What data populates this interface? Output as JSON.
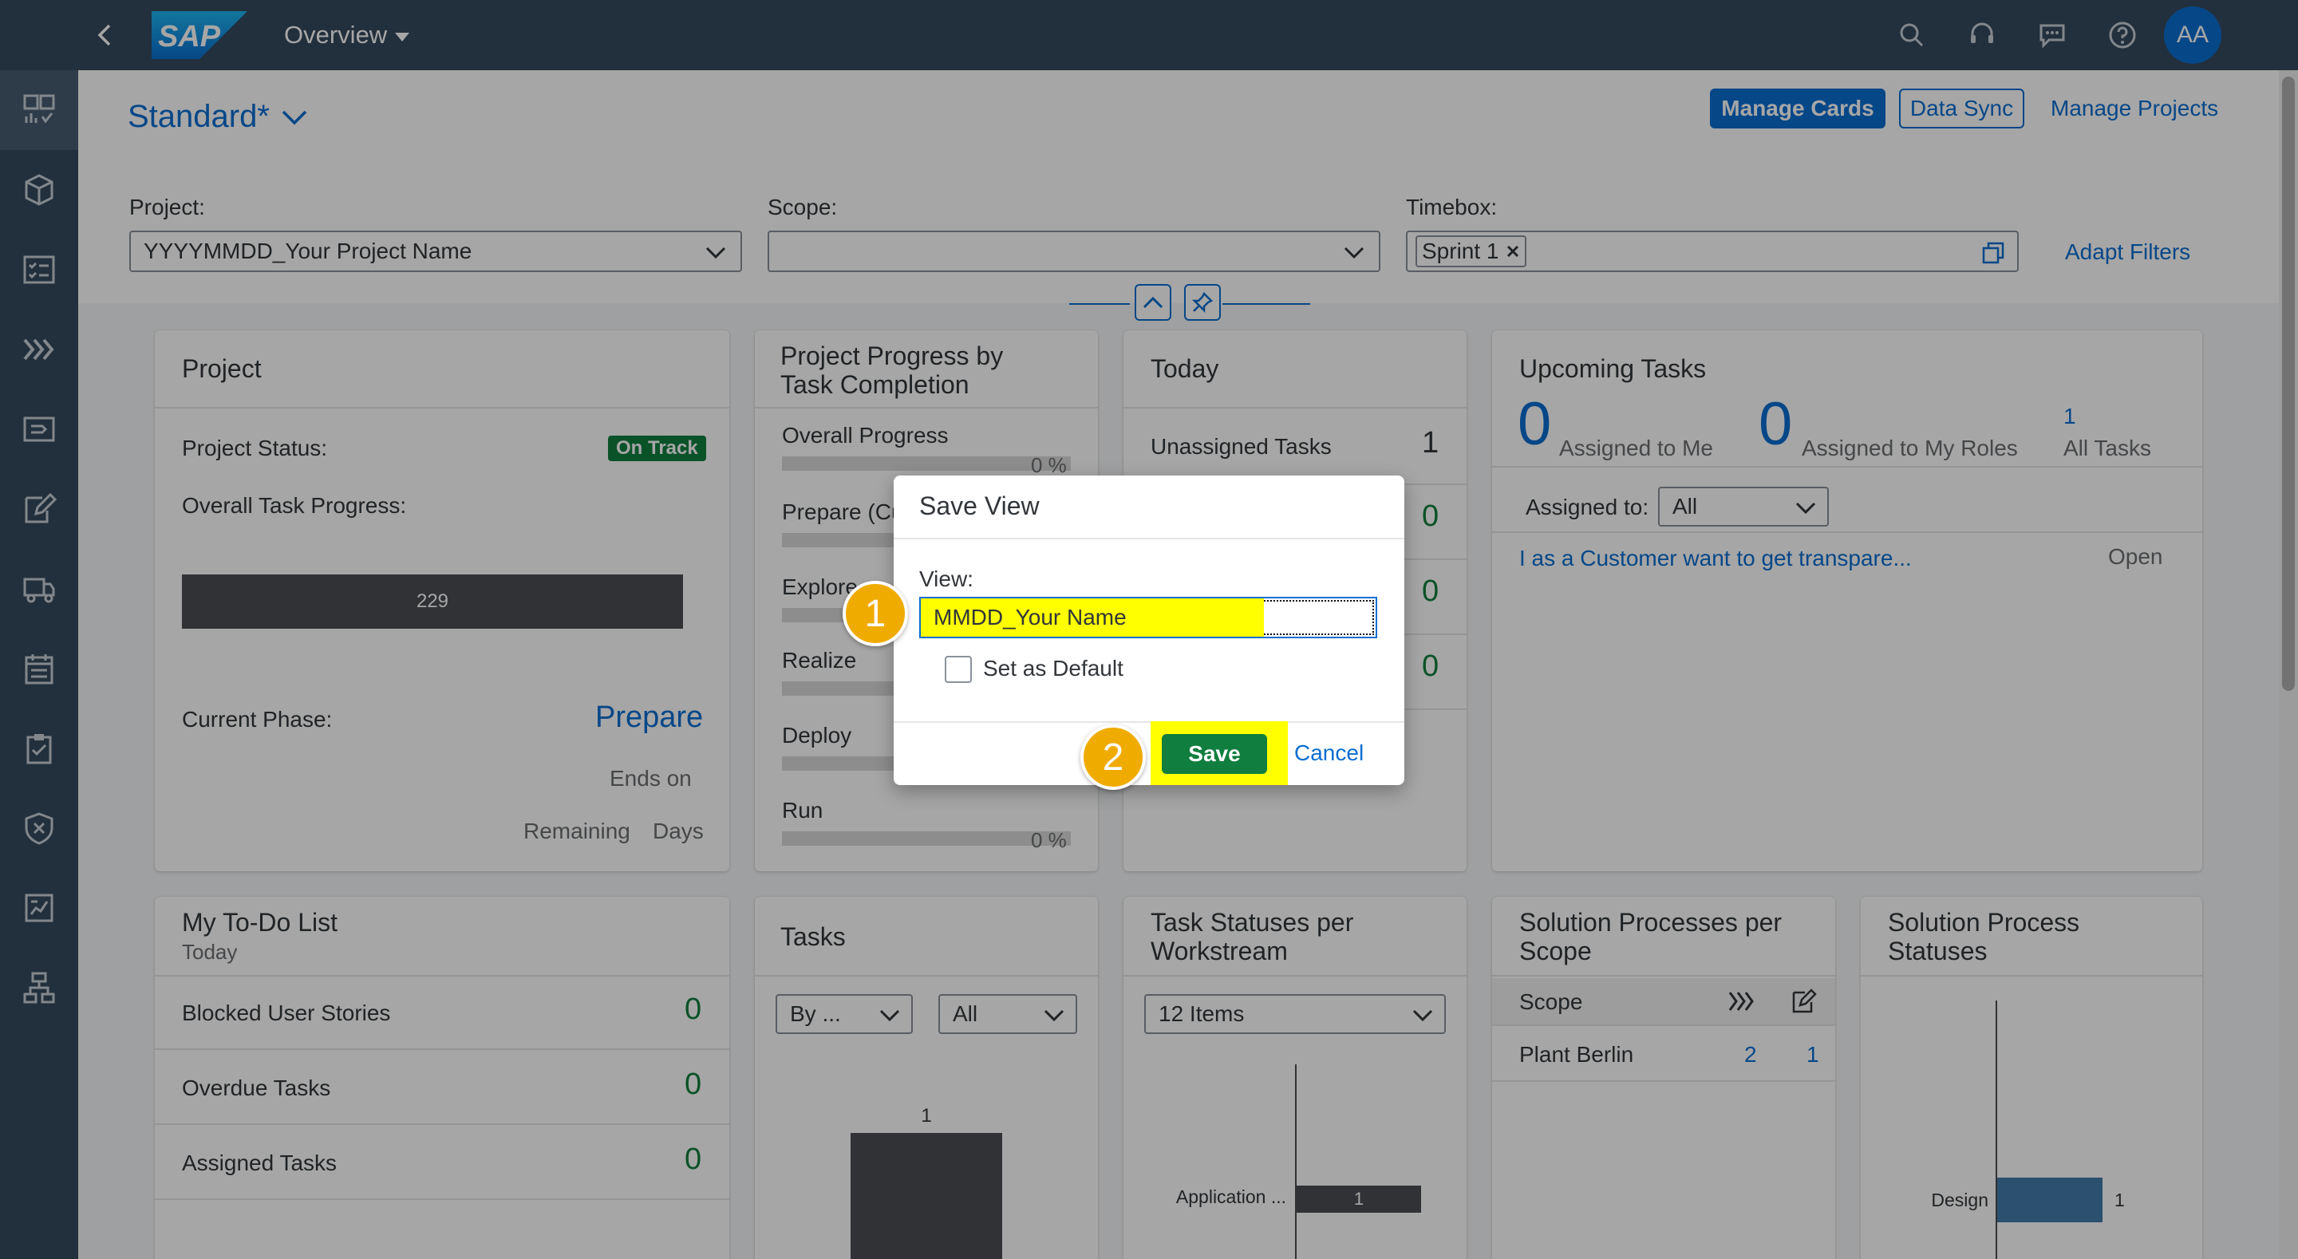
{
  "shell": {
    "title": "Overview",
    "avatar": "AA",
    "logo": "SAP"
  },
  "sidenav": [
    "overview-icon",
    "box-icon",
    "checklist-icon",
    "chevrons-icon",
    "ticket-icon",
    "edit-icon",
    "truck-icon",
    "calendar-icon",
    "clipboard-icon",
    "shield-icon",
    "report-icon",
    "hierarchy-icon"
  ],
  "header": {
    "variant": "Standard*",
    "manage_cards": "Manage Cards",
    "data_sync": "Data Sync",
    "manage_projects": "Manage Projects",
    "adapt_filters": "Adapt Filters",
    "filters": {
      "project_label": "Project:",
      "project_value": "YYYYMMDD_Your Project Name",
      "scope_label": "Scope:",
      "scope_value": "",
      "timebox_label": "Timebox:",
      "timebox_token": "Sprint 1"
    }
  },
  "project_card": {
    "title": "Project",
    "status_label": "Project Status:",
    "status_value": "On Track",
    "progress_label": "Overall Task Progress:",
    "progress_value": "229",
    "phase_label": "Current Phase:",
    "phase_value": "Prepare",
    "ends_on": "Ends on",
    "remaining": "Remaining",
    "days": "Days"
  },
  "progress_card": {
    "title_line1": "Project Progress by",
    "title_line2": "Task Completion",
    "overall_label": "Overall Progress",
    "overall_value": "0 %",
    "phases": [
      {
        "label": "Prepare (Cu"
      },
      {
        "label": "Explore"
      },
      {
        "label": "Realize"
      },
      {
        "label": "Deploy"
      },
      {
        "label": "Run",
        "value": "0 %"
      }
    ]
  },
  "today_card": {
    "title": "Today",
    "rows": [
      {
        "label": "Unassigned Tasks",
        "value": "1"
      },
      {
        "label": "",
        "value": "0"
      },
      {
        "label": "",
        "value": "0"
      },
      {
        "label": "",
        "value": "0"
      }
    ]
  },
  "upcoming_card": {
    "title": "Upcoming Tasks",
    "kpis": [
      {
        "value": "0",
        "label": "Assigned to Me"
      },
      {
        "value": "0",
        "label": "Assigned to My Roles"
      },
      {
        "value": "1",
        "label": "All Tasks"
      }
    ],
    "assigned_label": "Assigned to:",
    "assigned_value": "All",
    "task_title": "I as a Customer want to get transpare...",
    "task_status": "Open"
  },
  "todo_card": {
    "title": "My To-Do List",
    "subtitle": "Today",
    "rows": [
      {
        "label": "Blocked User Stories",
        "value": "0"
      },
      {
        "label": "Overdue Tasks",
        "value": "0"
      },
      {
        "label": "Assigned Tasks",
        "value": "0"
      }
    ]
  },
  "tasks_card": {
    "title": "Tasks",
    "select1": "By ...",
    "select2": "All",
    "bar_label": "1"
  },
  "statuses_card": {
    "title_line1": "Task Statuses per",
    "title_line2": "Workstream",
    "select": "12 Items",
    "bar_category": "Application ...",
    "bar_value": "1"
  },
  "processes_card": {
    "title_line1": "Solution Processes per",
    "title_line2": "Scope",
    "col_scope": "Scope",
    "row_label": "Plant Berlin",
    "row_val1": "2",
    "row_val2": "1"
  },
  "process_status_card": {
    "title_line1": "Solution Process",
    "title_line2": "Statuses",
    "category": "Design",
    "value": "1"
  },
  "chart_data": [
    {
      "type": "bar",
      "categories": [
        ""
      ],
      "values": [
        1
      ]
    },
    {
      "type": "bar",
      "categories": [
        "Application ..."
      ],
      "values": [
        1
      ]
    },
    {
      "type": "bar",
      "categories": [
        "Design"
      ],
      "values": [
        1
      ]
    }
  ],
  "dialog": {
    "title": "Save View",
    "view_label": "View:",
    "view_value": "MMDD_Your Name",
    "default_label": "Set as Default",
    "save": "Save",
    "cancel": "Cancel"
  },
  "steps": [
    "1",
    "2"
  ],
  "colors": {
    "shell": "#354a5f",
    "accent": "#0a6ed1",
    "positive": "#107e3e",
    "highlight": "#ffff00",
    "step": "#f0ab00"
  }
}
